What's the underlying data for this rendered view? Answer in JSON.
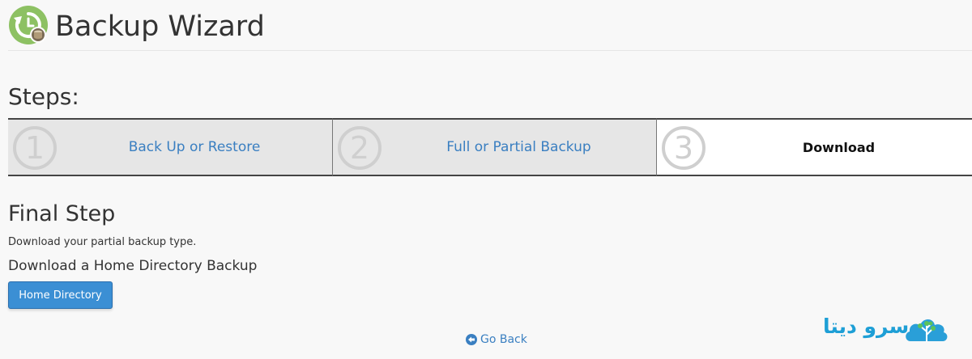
{
  "header": {
    "title": "Backup Wizard",
    "icon": "backup-restore-icon"
  },
  "steps": {
    "heading": "Steps:",
    "items": [
      {
        "number": "1",
        "label": "Back Up or Restore",
        "state": "link"
      },
      {
        "number": "2",
        "label": "Full or Partial Backup",
        "state": "link"
      },
      {
        "number": "3",
        "label": "Download",
        "state": "active"
      }
    ]
  },
  "final_step": {
    "heading": "Final Step",
    "description": "Download your partial backup type.",
    "sub_heading": "Download a Home Directory Backup",
    "button_label": "Home Directory"
  },
  "footer": {
    "go_back_label": "Go Back",
    "go_back_icon": "arrow-circle-left-icon"
  },
  "watermark": {
    "text": "سرو دیتا",
    "logo": "cloud-tree-logo"
  },
  "colors": {
    "link": "#3a7fc1",
    "primary_button": "#3b8fd4",
    "step_inactive_bg": "#e6e6e6",
    "step_active_bg": "#ffffff",
    "icon_green": "#8dc163"
  }
}
